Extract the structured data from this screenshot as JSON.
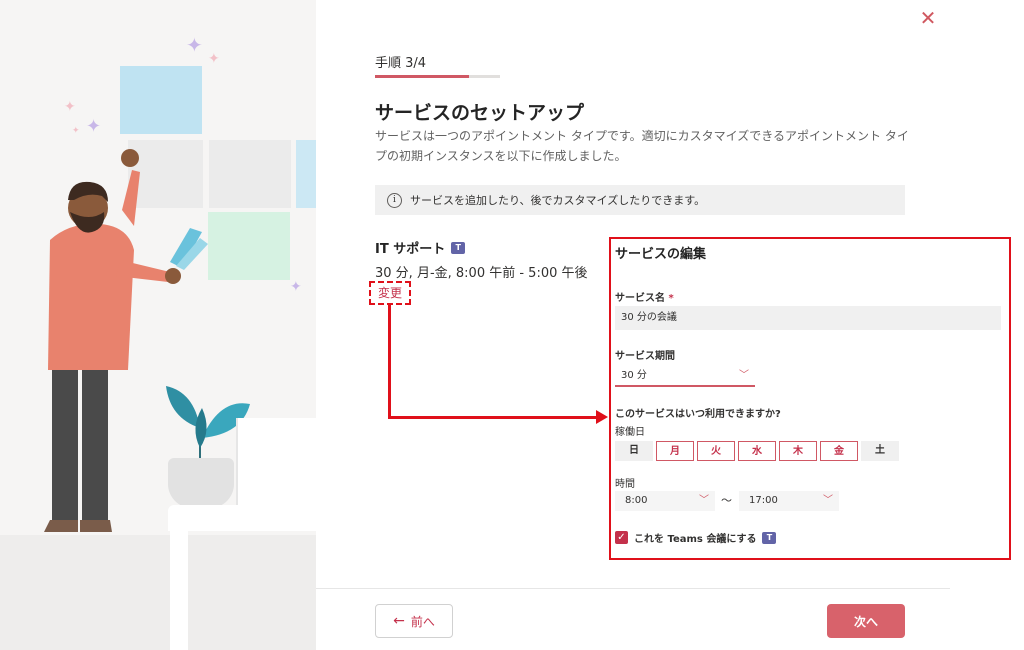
{
  "wizard": {
    "step_label": "手順 3/4",
    "progress": 0.75,
    "title": "サービスのセットアップ",
    "description": "サービスは一つのアポイントメント タイプです。適切にカスタマイズできるアポイントメント タイプの初期インスタンスを以下に作成しました。",
    "info_text": "サービスを追加したり、後でカスタマイズしたりできます。"
  },
  "service": {
    "name": "IT サポート",
    "detail": "30 分, 月-金, 8:00 午前 - 5:00 午後",
    "change_link": "変更"
  },
  "edit": {
    "title": "サービスの編集",
    "name_label": "サービス名",
    "required_mark": "*",
    "name_value": "30 分の会議",
    "duration_label": "サービス期間",
    "duration_value": "30 分",
    "availability_label": "このサービスはいつ利用できますか?",
    "workdays_label": "稼働日",
    "days": [
      {
        "label": "日",
        "selected": false
      },
      {
        "label": "月",
        "selected": true
      },
      {
        "label": "火",
        "selected": true
      },
      {
        "label": "水",
        "selected": true
      },
      {
        "label": "木",
        "selected": true
      },
      {
        "label": "金",
        "selected": true
      },
      {
        "label": "土",
        "selected": false
      }
    ],
    "time_label": "時間",
    "start_time": "8:00",
    "separator": "〜",
    "end_time": "17:00",
    "teams_label": "これを Teams 会議にする",
    "teams_checked": true
  },
  "footer": {
    "back_label": "前へ",
    "next_label": "次へ"
  },
  "colors": {
    "accent": "#d05864",
    "highlight_red": "#e0101a",
    "teams_purple": "#6264a7"
  }
}
